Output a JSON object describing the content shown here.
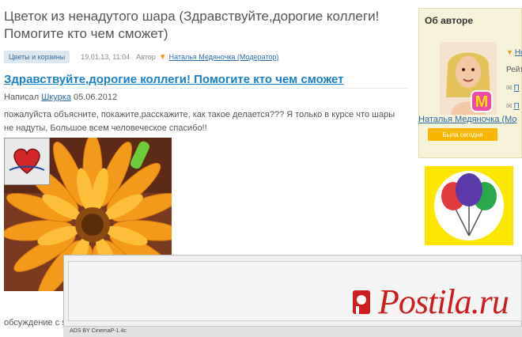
{
  "page_title": "Цветок из ненадутого шара (Здравствуйте,дорогие коллеги! Помогите кто чем сможет)",
  "meta": {
    "category": "Цветы и корзины",
    "date": "19.01.13, 11:04",
    "author_word": "Автор",
    "author_link": "Наталья Медяночка (Модератор)"
  },
  "article": {
    "title": "Здравствуйте,дорогие коллеги! Помогите кто чем сможет",
    "byline_prefix": "Написал",
    "byline_author": "Шкурка",
    "byline_date": "05.06.2012",
    "body": "пожалуйста объясните, покажите,расскажите, как такое делается??? Я только в курсе что шары не надуты, Большое всем человеческое спасибо!!"
  },
  "discussion_label": "обсуждение с s",
  "sidebar": {
    "title": "Об авторе",
    "author_name": "Наталья Медяночка (Мо",
    "online_badge": "Была сегодня",
    "links": [
      "Не",
      "Рейт",
      "П",
      "П"
    ]
  },
  "ad": {
    "label": "ADS BY CinemaP-1.4c"
  },
  "watermark": {
    "text": "Postila.ru"
  },
  "colors": {
    "link": "#2a6aa8",
    "title_link": "#1a80c8",
    "tag_bg": "#dde7f0",
    "sidebar_bg": "#f7f3d8",
    "badge": "#f5b700",
    "watermark": "#cc1e1e",
    "balloon_bg": "#fde600"
  }
}
